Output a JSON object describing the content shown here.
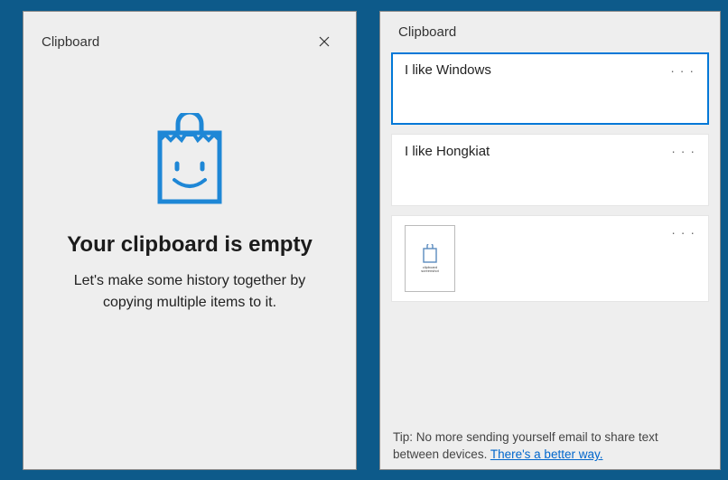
{
  "colors": {
    "accent": "#0078d7"
  },
  "empty_panel": {
    "title": "Clipboard",
    "heading": "Your clipboard is empty",
    "subtext": "Let's make some history together by copying multiple items to it.",
    "icon_name": "clipboard-smile-icon"
  },
  "history_panel": {
    "title": "Clipboard",
    "items": [
      {
        "type": "text",
        "text": "I like Windows",
        "selected": true
      },
      {
        "type": "text",
        "text": "I like Hongkiat",
        "selected": false
      },
      {
        "type": "image",
        "thumb_label": "screenshot",
        "selected": false
      }
    ],
    "tip_prefix": "Tip: ",
    "tip_text": "No more sending yourself email to share text between devices.  ",
    "tip_link": "There's a better way."
  }
}
